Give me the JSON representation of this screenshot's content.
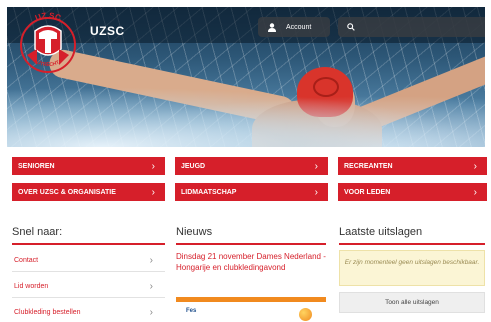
{
  "header": {
    "brand": "UZSC",
    "logo_text_top": "UZ SC",
    "logo_text_bottom": "UTRECHT",
    "account_label": "Account",
    "search_placeholder": ""
  },
  "nav": {
    "items": [
      {
        "label": "SENIOREN"
      },
      {
        "label": "JEUGD"
      },
      {
        "label": "RECREANTEN"
      },
      {
        "label": "OVER UZSC & ORGANISATIE"
      },
      {
        "label": "LIDMAATSCHAP"
      },
      {
        "label": "VOOR LEDEN"
      }
    ],
    "chevron": "›"
  },
  "quick_links": {
    "title": "Snel naar:",
    "items": [
      {
        "label": "Contact"
      },
      {
        "label": "Lid worden"
      },
      {
        "label": "Clubkleding bestellen"
      }
    ]
  },
  "news": {
    "title": "Nieuws",
    "headline": "Dinsdag 21 november Dames Nederland - Hongarije en clubkledingavond",
    "image_caption": "Fes"
  },
  "results": {
    "title": "Laatste uitslagen",
    "empty_message": "Er zijn momenteel geen uitslagen beschikbaar.",
    "button_label": "Toon alle uitslagen"
  },
  "colors": {
    "accent": "#d61f2a",
    "notice_bg": "#fbf5d5"
  },
  "icons": [
    "user-icon",
    "search-icon",
    "chevron-right-icon"
  ]
}
